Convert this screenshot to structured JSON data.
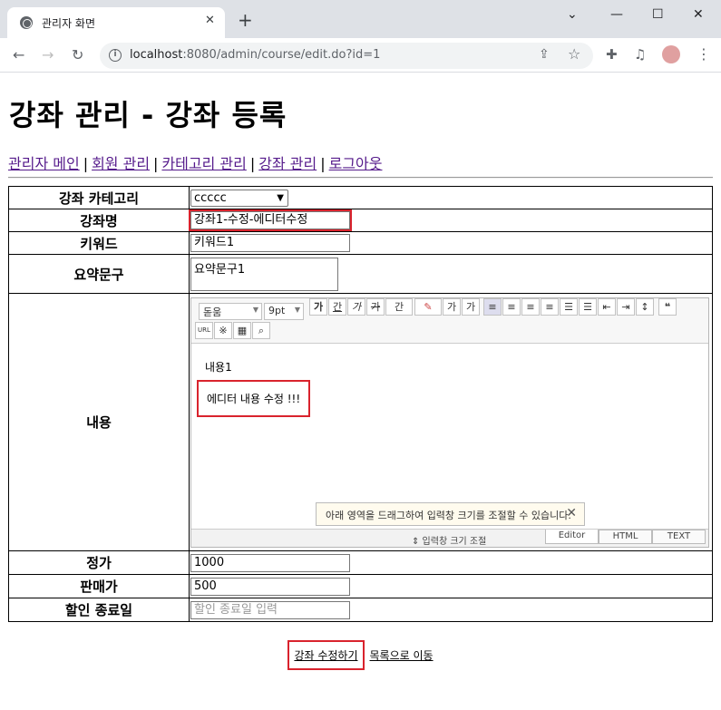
{
  "browser": {
    "tab_title": "관리자 화면",
    "tab_close": "✕",
    "new_tab": "+",
    "url_host": "localhost",
    "url_rest": ":8080/admin/course/edit.do?id=1",
    "info_icon": "i"
  },
  "page": {
    "title": "강좌 관리 - 강좌 등록",
    "nav": {
      "admin_main": "관리자 메인",
      "members": "회원 관리",
      "categories": "카테고리 관리",
      "courses": "강좌 관리",
      "logout": "로그아웃",
      "separator": "|"
    }
  },
  "form": {
    "category_label": "강좌 카테고리",
    "category_value": "ccccc",
    "name_label": "강좌명",
    "name_value": "강좌1-수정-에디터수정",
    "keyword_label": "키워드",
    "keyword_value": "키워드1",
    "summary_label": "요약문구",
    "summary_value": "요약문구1",
    "content_label": "내용",
    "price_label": "정가",
    "price_value": "1000",
    "sale_price_label": "판매가",
    "sale_price_value": "500",
    "sale_end_label": "할인 종료일",
    "sale_end_placeholder": "할인 종료일 입력"
  },
  "editor": {
    "font": "돋움",
    "size": "9pt",
    "bold": "가",
    "underline": "간",
    "italic": "가",
    "strike": "가",
    "fontcolor": "간",
    "superscript": "가",
    "subscript": "가",
    "url": "URL",
    "quote": "❝",
    "line1": "내용1",
    "line2": "에디터 내용 수정 !!!",
    "tooltip": "아래 영역을 드래그하여 입력창 크기를 조절할 수 있습니다.",
    "tooltip_close": "✕",
    "resize_label": "⇕ 입력창 크기 조절",
    "mode_editor": "Editor",
    "mode_html": "HTML",
    "mode_text": "TEXT"
  },
  "actions": {
    "submit": "강좌 수정하기",
    "list": "목록으로 이동"
  }
}
